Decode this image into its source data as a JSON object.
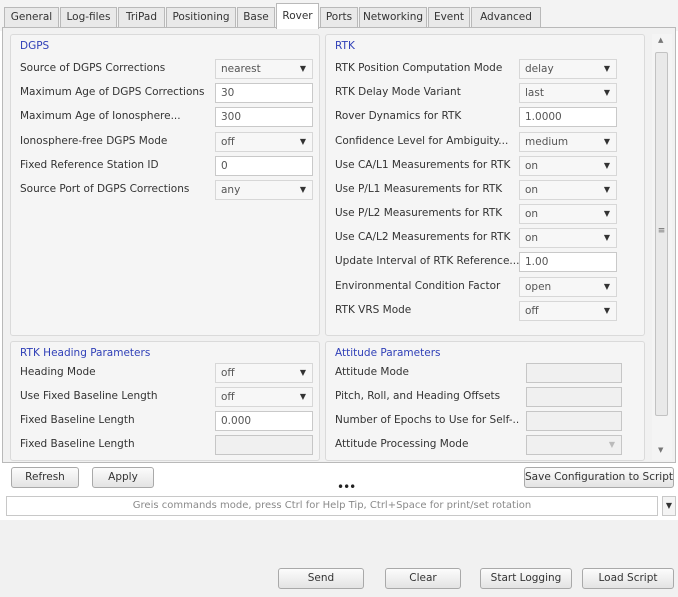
{
  "tabs": [
    "General",
    "Log-files",
    "TriPad",
    "Positioning",
    "Base",
    "Rover",
    "Ports",
    "Networking",
    "Event",
    "Advanced"
  ],
  "active_tab": "Rover",
  "dgps": {
    "title": "DGPS",
    "rows": [
      {
        "label": "Source of DGPS Corrections",
        "value": "nearest",
        "type": "select"
      },
      {
        "label": "Maximum Age of DGPS Corrections",
        "value": "30",
        "type": "text"
      },
      {
        "label": "Maximum Age of Ionosphere...",
        "value": "300",
        "type": "text"
      },
      {
        "label": "Ionosphere-free DGPS Mode",
        "value": "off",
        "type": "select"
      },
      {
        "label": "Fixed Reference Station ID",
        "value": "0",
        "type": "text"
      },
      {
        "label": "Source Port of DGPS Corrections",
        "value": "any",
        "type": "select"
      }
    ]
  },
  "rtk": {
    "title": "RTK",
    "rows": [
      {
        "label": "RTK Position Computation Mode",
        "value": "delay",
        "type": "select"
      },
      {
        "label": "RTK Delay Mode Variant",
        "value": "last",
        "type": "select"
      },
      {
        "label": "Rover Dynamics for RTK",
        "value": "1.0000",
        "type": "text"
      },
      {
        "label": "Confidence Level for Ambiguity...",
        "value": "medium",
        "type": "select"
      },
      {
        "label": "Use CA/L1 Measurements for RTK",
        "value": "on",
        "type": "select"
      },
      {
        "label": "Use P/L1 Measurements for RTK",
        "value": "on",
        "type": "select"
      },
      {
        "label": "Use P/L2 Measurements for RTK",
        "value": "on",
        "type": "select"
      },
      {
        "label": "Use CA/L2 Measurements for RTK",
        "value": "on",
        "type": "select"
      },
      {
        "label": "Update Interval of RTK Reference...",
        "value": "1.00",
        "type": "text"
      },
      {
        "label": "Environmental Condition Factor",
        "value": "open",
        "type": "select"
      },
      {
        "label": "RTK VRS Mode",
        "value": "off",
        "type": "select"
      }
    ]
  },
  "heading": {
    "title": "RTK Heading Parameters",
    "rows": [
      {
        "label": "Heading Mode",
        "value": "off",
        "type": "select"
      },
      {
        "label": "Use Fixed Baseline Length",
        "value": "off",
        "type": "select"
      },
      {
        "label": "Fixed Baseline Length",
        "value": "0.000",
        "type": "text"
      },
      {
        "label": "Fixed Baseline Length",
        "value": "",
        "type": "disabled"
      }
    ]
  },
  "attitude": {
    "title": "Attitude Parameters",
    "rows": [
      {
        "label": "Attitude Mode",
        "value": "",
        "type": "disabled"
      },
      {
        "label": "Pitch, Roll, and Heading Offsets",
        "value": "",
        "type": "disabled"
      },
      {
        "label": "Number of Epochs to Use for Self-...",
        "value": "",
        "type": "disabled"
      },
      {
        "label": "Attitude Processing Mode",
        "value": "",
        "type": "disabled-select"
      }
    ]
  },
  "buttons": {
    "refresh": "Refresh",
    "apply": "Apply",
    "save_config": "Save Configuration to Script",
    "send": "Send",
    "clear": "Clear",
    "start_logging": "Start Logging",
    "load_script": "Load Script"
  },
  "splitter_handle": "•••",
  "command": {
    "placeholder": "Greis commands mode, press Ctrl for Help Tip, Ctrl+Space for print/set rotation"
  },
  "icons": {
    "dropdown": "chevron-down-icon",
    "scroll_up": "arrow-up-icon",
    "scroll_down": "arrow-down-icon",
    "grip": "scrollbar-grip-icon"
  },
  "colors": {
    "group_title": "#2f3fb7",
    "panel_bg": "#f1f1f1"
  }
}
